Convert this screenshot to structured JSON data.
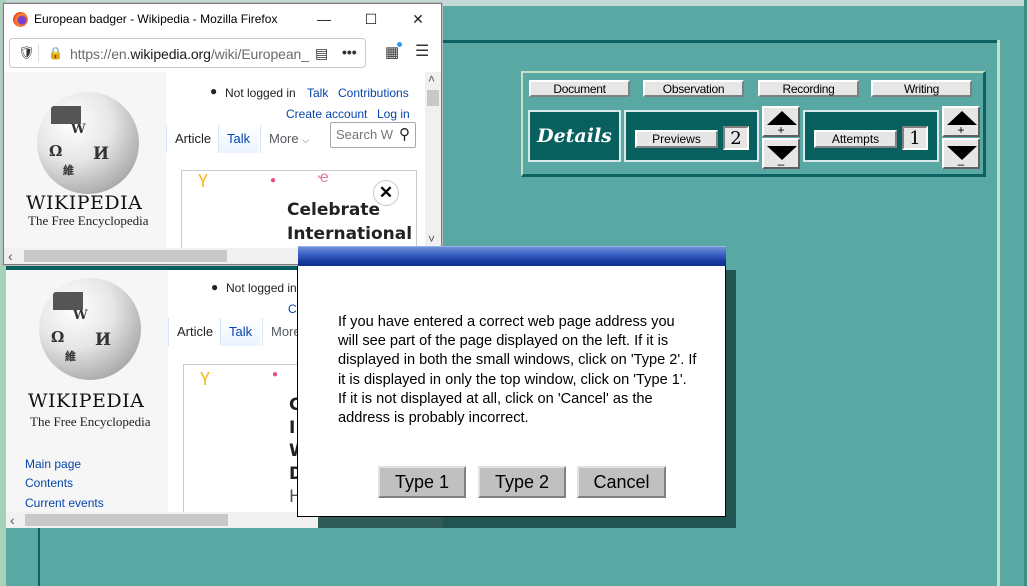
{
  "browser": {
    "title": "European badger - Wikipedia - Mozilla Firefox",
    "url_prefix": "https://en.",
    "url_domain": "wikipedia.org",
    "url_path": "/wiki/European_",
    "icons": {
      "shield": "shield-icon",
      "lock": "lock-icon",
      "reader": "reader-view-icon",
      "more": "more-icon",
      "gift": "whats-new-icon",
      "menu": "hamburger-menu-icon"
    }
  },
  "window_controls": {
    "minimize": "—",
    "maximize": "☐",
    "close": "✕"
  },
  "wiki": {
    "not_logged_in": "Not logged in",
    "talk_link": "Talk",
    "contributions": "Contributions",
    "create_account": "Create account",
    "log_in": "Log in",
    "wordmark": "WIKIPEDIA",
    "tagline": "The Free Encyclopedia",
    "tabs": {
      "article": "Article",
      "talk": "Talk",
      "more": "More"
    },
    "search_placeholder": "Search W",
    "banner_line1": "Celebrate",
    "banner_line2": "International",
    "banner_close": "✕",
    "nav": [
      "Main page",
      "Contents",
      "Current events"
    ],
    "banner_partial": [
      "C",
      "I",
      "W",
      "D",
      "H"
    ],
    "cropped_link": "C",
    "more_partial": "More"
  },
  "panel": {
    "tabs": [
      "Document",
      "Observation",
      "Recording",
      "Writing"
    ],
    "details_label": "Details",
    "previews_label": "Previews",
    "previews_value": "2",
    "attempts_label": "Attempts",
    "attempts_value": "1",
    "plus": "+",
    "minus": "–"
  },
  "dialog": {
    "message": "If you have entered a correct web page address you will see part of the page displayed on the left. If it is displayed in both the small windows, click on 'Type 2'. If it is displayed in only the top window, click on 'Type 1'. If it is not displayed at all, click on 'Cancel' as the address is probably incorrect.",
    "buttons": {
      "type1": "Type 1",
      "type2": "Type 2",
      "cancel": "Cancel"
    }
  },
  "scroll": {
    "left_arrow": "‹",
    "right_arrow": "›",
    "up_arrow": "˄",
    "down_arrow": "˅"
  }
}
